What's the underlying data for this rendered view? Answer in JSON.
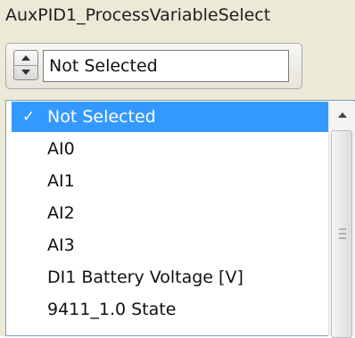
{
  "field": {
    "title": "AuxPID1_ProcessVariableSelect",
    "value": "Not Selected"
  },
  "dropdown": {
    "items": [
      {
        "label": "Not Selected",
        "selected": true
      },
      {
        "label": "AI0",
        "selected": false
      },
      {
        "label": "AI1",
        "selected": false
      },
      {
        "label": "AI2",
        "selected": false
      },
      {
        "label": "AI3",
        "selected": false
      },
      {
        "label": "DI1 Battery Voltage [V]",
        "selected": false
      },
      {
        "label": "9411_1.0 State",
        "selected": false
      }
    ],
    "check_glyph": "✓"
  },
  "icons": {
    "spinner_up": "triangle-up-icon",
    "spinner_down": "triangle-down-icon",
    "scroll_up": "scroll-up-arrow-icon",
    "scroll_grip": "scroll-grip-icon"
  },
  "colors": {
    "selection": "#3399ff",
    "panel": "#ece9d8"
  }
}
